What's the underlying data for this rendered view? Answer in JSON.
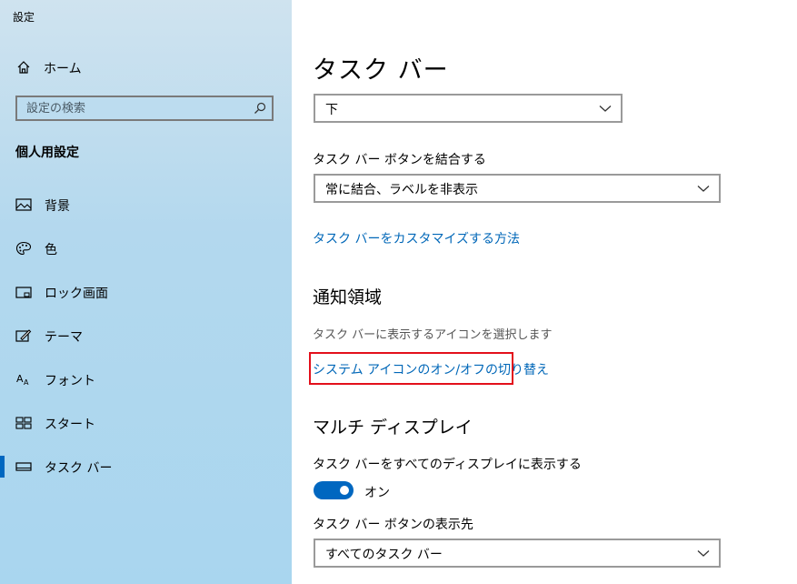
{
  "window": {
    "title": "設定"
  },
  "sidebar": {
    "home_label": "ホーム",
    "search_placeholder": "設定の検索",
    "section_title": "個人用設定",
    "items": [
      {
        "label": "背景",
        "icon": "image-icon"
      },
      {
        "label": "色",
        "icon": "palette-icon"
      },
      {
        "label": "ロック画面",
        "icon": "lock-screen-icon"
      },
      {
        "label": "テーマ",
        "icon": "theme-icon"
      },
      {
        "label": "フォント",
        "icon": "font-icon"
      },
      {
        "label": "スタート",
        "icon": "start-icon"
      },
      {
        "label": "タスク バー",
        "icon": "taskbar-icon",
        "selected": true
      }
    ]
  },
  "main": {
    "page_title": "タスク バー",
    "position_dropdown_value": "下",
    "combine_label": "タスク バー ボタンを結合する",
    "combine_dropdown_value": "常に結合、ラベルを非表示",
    "customize_link": "タスク バーをカスタマイズする方法",
    "notification_heading": "通知領域",
    "notification_desc": "タスク バーに表示するアイコンを選択します",
    "system_icons_link": "システム アイコンのオン/オフの切り替え",
    "multi_display_heading": "マルチ ディスプレイ",
    "show_all_displays_label": "タスク バーをすべてのディスプレイに表示する",
    "toggle_state_label": "オン",
    "toggle_on": true,
    "show_buttons_on_label": "タスク バー ボタンの表示先",
    "show_buttons_on_value": "すべてのタスク バー"
  },
  "colors": {
    "accent": "#0067c0",
    "link": "#0067b8",
    "highlight": "#e3101b"
  }
}
